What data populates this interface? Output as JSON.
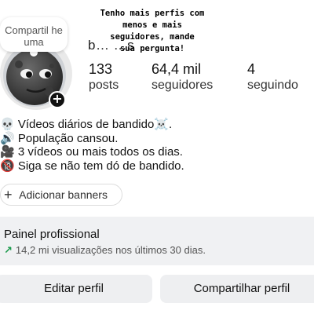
{
  "note": {
    "text": "Compartil he uma"
  },
  "overlay": {
    "text": "Tenho mais perfis com\nmenos e mais\nseguidores, mande\nsua pergunta!"
  },
  "profile": {
    "username": "b… …s"
  },
  "stats": [
    {
      "value": "133",
      "label": "posts"
    },
    {
      "value": "64,4 mil",
      "label": "seguidores"
    },
    {
      "value": "4",
      "label": "seguindo"
    }
  ],
  "bio": [
    "💀 Vídeos diários de bandido☠️.",
    "🔊 População cansou.",
    "🎥 3 vídeos ou mais todos os dias.",
    "🔞 Siga se não tem dó de bandido."
  ],
  "banners": {
    "label": "Adicionar banners"
  },
  "professional": {
    "title": "Painel profissional",
    "subtitle": "14,2 mi visualizações nos últimos 30 dias."
  },
  "buttons": {
    "edit": "Editar perfil",
    "share": "Compartilhar perfil"
  },
  "colors": {
    "growth_arrow": "#1a9a4b",
    "panel_bg": "#f0f1f3",
    "button_bg": "#eeeff1"
  }
}
